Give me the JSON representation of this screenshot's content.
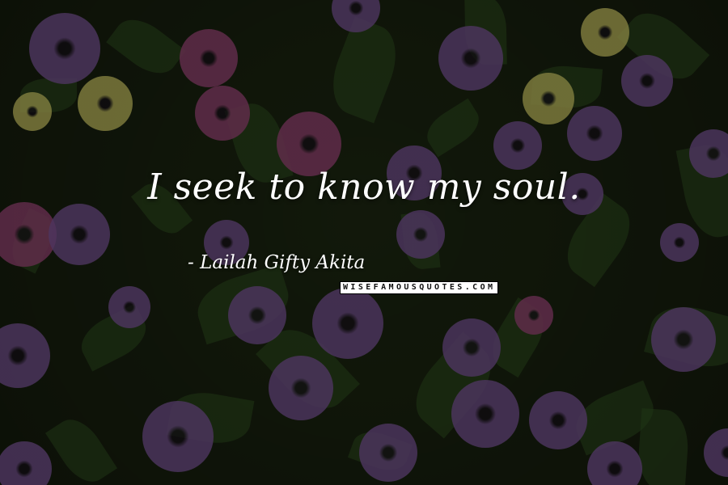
{
  "quote": {
    "text": "I seek to know my soul."
  },
  "author": {
    "name": "- Lailah Gifty Akita"
  },
  "watermark": {
    "text": "WISEFAMOUSQUOTES.COM"
  },
  "colors": {
    "background": "#18200f",
    "flower_purple": "#6e4a8a",
    "flower_pink": "#8e3d6e",
    "flower_yellow": "#b9b35a",
    "leaf_green": "#2c4a1f",
    "text": "#ffffff"
  }
}
